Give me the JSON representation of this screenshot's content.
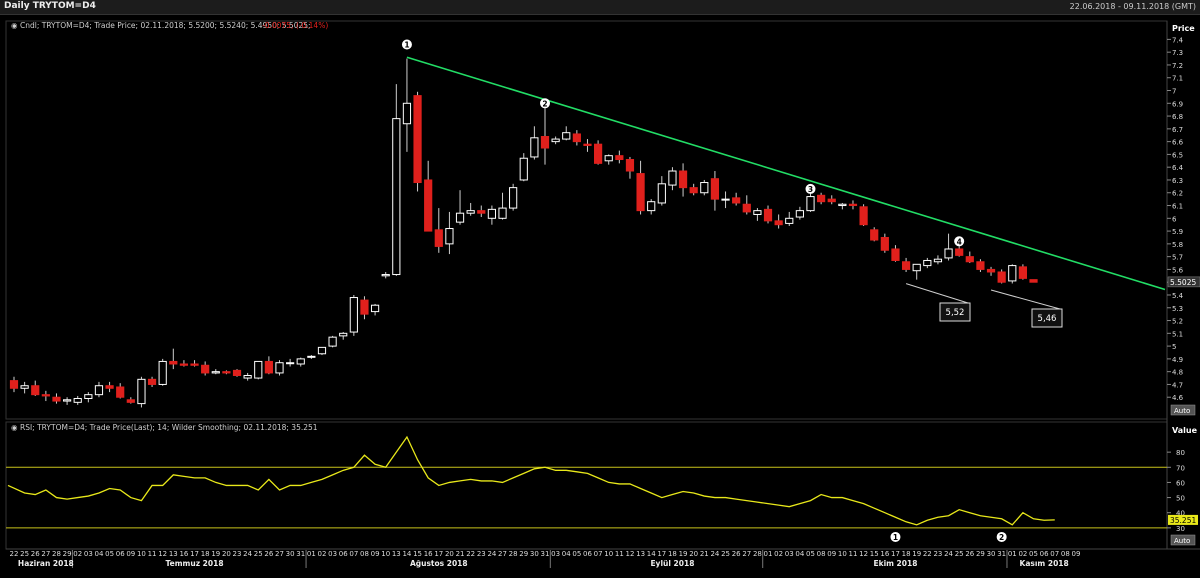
{
  "window": {
    "title": "Daily TRYTOM=D4",
    "date_range": "22.06.2018 - 09.11.2018 (GMT)"
  },
  "colors": {
    "up": "#ffffff",
    "down": "#e0201c",
    "trend": "#22dd66",
    "rsi": "#e8e81a",
    "band": "#c8c21a",
    "bg": "#000000",
    "grid": "#2a2a2a"
  },
  "chart_data": [
    {
      "type": "candlestick",
      "legend_prefix": "Cndl; TRYTOM=D4; Trade Price; 02.11.2018; 5.5200; 5.5240; 5.4950; 5.5025;",
      "legend_change": "-0.0075; (-0.14%)",
      "y_title": "Price",
      "ylim": [
        4.5,
        7.45
      ],
      "y_ticks": [
        "4.6",
        "4.7",
        "4.8",
        "4.9",
        "5",
        "5.1",
        "5.2",
        "5.3",
        "5.4",
        "5.5",
        "5.6",
        "5.7",
        "5.8",
        "5.9",
        "6",
        "6.1",
        "6.2",
        "6.3",
        "6.4",
        "6.5",
        "6.6",
        "6.7",
        "6.8",
        "6.9",
        "7",
        "7.1",
        "7.2",
        "7.3",
        "7.4"
      ],
      "last_price": "5.5025",
      "scale_button": "Auto",
      "ohlc": [
        [
          4.73,
          4.76,
          4.64,
          4.67
        ],
        [
          4.67,
          4.72,
          4.63,
          4.69
        ],
        [
          4.69,
          4.73,
          4.61,
          4.62
        ],
        [
          4.62,
          4.65,
          4.57,
          4.61
        ],
        [
          4.6,
          4.63,
          4.55,
          4.57
        ],
        [
          4.57,
          4.6,
          4.54,
          4.58
        ],
        [
          4.56,
          4.61,
          4.54,
          4.59
        ],
        [
          4.59,
          4.64,
          4.56,
          4.62
        ],
        [
          4.62,
          4.72,
          4.6,
          4.69
        ],
        [
          4.69,
          4.72,
          4.64,
          4.67
        ],
        [
          4.68,
          4.71,
          4.59,
          4.6
        ],
        [
          4.58,
          4.6,
          4.55,
          4.56
        ],
        [
          4.55,
          4.76,
          4.52,
          4.74
        ],
        [
          4.74,
          4.76,
          4.68,
          4.7
        ],
        [
          4.7,
          4.9,
          4.69,
          4.88
        ],
        [
          4.88,
          4.98,
          4.82,
          4.86
        ],
        [
          4.86,
          4.89,
          4.84,
          4.85
        ],
        [
          4.86,
          4.89,
          4.84,
          4.85
        ],
        [
          4.85,
          4.88,
          4.77,
          4.79
        ],
        [
          4.79,
          4.82,
          4.78,
          4.8
        ],
        [
          4.8,
          4.81,
          4.78,
          4.79
        ],
        [
          4.81,
          4.82,
          4.76,
          4.77
        ],
        [
          4.75,
          4.79,
          4.73,
          4.77
        ],
        [
          4.75,
          4.88,
          4.74,
          4.88
        ],
        [
          4.88,
          4.92,
          4.78,
          4.79
        ],
        [
          4.79,
          4.89,
          4.77,
          4.87
        ],
        [
          4.87,
          4.9,
          4.84,
          4.87
        ],
        [
          4.86,
          4.91,
          4.84,
          4.9
        ],
        [
          4.92,
          4.93,
          4.9,
          4.92
        ],
        [
          4.94,
          4.99,
          4.93,
          4.99
        ],
        [
          5.0,
          5.08,
          4.99,
          5.07
        ],
        [
          5.08,
          5.11,
          5.05,
          5.1
        ],
        [
          5.11,
          5.4,
          5.08,
          5.38
        ],
        [
          5.36,
          5.39,
          5.21,
          5.25
        ],
        [
          5.27,
          5.33,
          5.24,
          5.32
        ],
        [
          5.55,
          5.58,
          5.53,
          5.56
        ],
        [
          5.56,
          7.05,
          5.55,
          6.78
        ],
        [
          6.74,
          7.25,
          6.52,
          6.9
        ],
        [
          6.96,
          6.99,
          6.21,
          6.28
        ],
        [
          6.3,
          6.45,
          5.96,
          5.9
        ],
        [
          5.91,
          6.08,
          5.73,
          5.78
        ],
        [
          5.8,
          6.05,
          5.72,
          5.92
        ],
        [
          5.97,
          6.22,
          5.95,
          6.04
        ],
        [
          6.04,
          6.12,
          6.02,
          6.06
        ],
        [
          6.06,
          6.1,
          6.01,
          6.04
        ],
        [
          6.0,
          6.1,
          5.95,
          6.07
        ],
        [
          6.0,
          6.2,
          5.99,
          6.08
        ],
        [
          6.08,
          6.27,
          6.06,
          6.24
        ],
        [
          6.3,
          6.51,
          6.29,
          6.47
        ],
        [
          6.48,
          6.72,
          6.46,
          6.63
        ],
        [
          6.64,
          6.87,
          6.42,
          6.55
        ],
        [
          6.6,
          6.64,
          6.58,
          6.62
        ],
        [
          6.62,
          6.72,
          6.61,
          6.67
        ],
        [
          6.66,
          6.69,
          6.57,
          6.6
        ],
        [
          6.58,
          6.62,
          6.52,
          6.57
        ],
        [
          6.58,
          6.61,
          6.42,
          6.43
        ],
        [
          6.45,
          6.5,
          6.42,
          6.49
        ],
        [
          6.49,
          6.53,
          6.43,
          6.46
        ],
        [
          6.46,
          6.48,
          6.31,
          6.37
        ],
        [
          6.35,
          6.45,
          6.03,
          6.06
        ],
        [
          6.06,
          6.15,
          6.03,
          6.13
        ],
        [
          6.12,
          6.33,
          6.1,
          6.27
        ],
        [
          6.26,
          6.4,
          6.22,
          6.37
        ],
        [
          6.37,
          6.43,
          6.17,
          6.24
        ],
        [
          6.24,
          6.27,
          6.18,
          6.2
        ],
        [
          6.2,
          6.3,
          6.18,
          6.28
        ],
        [
          6.31,
          6.37,
          6.06,
          6.15
        ],
        [
          6.15,
          6.21,
          6.08,
          6.15
        ],
        [
          6.16,
          6.2,
          6.1,
          6.12
        ],
        [
          6.11,
          6.18,
          6.03,
          6.05
        ],
        [
          6.03,
          6.08,
          5.98,
          6.06
        ],
        [
          6.07,
          6.1,
          5.96,
          5.98
        ],
        [
          5.98,
          6.03,
          5.92,
          5.95
        ],
        [
          5.96,
          6.05,
          5.94,
          6.0
        ],
        [
          6.01,
          6.09,
          5.99,
          6.06
        ],
        [
          6.06,
          6.25,
          6.05,
          6.17
        ],
        [
          6.18,
          6.2,
          6.11,
          6.13
        ],
        [
          6.15,
          6.18,
          6.11,
          6.13
        ],
        [
          6.1,
          6.12,
          6.07,
          6.11
        ],
        [
          6.11,
          6.14,
          6.07,
          6.1
        ],
        [
          6.09,
          6.11,
          5.94,
          5.95
        ],
        [
          5.91,
          5.93,
          5.82,
          5.83
        ],
        [
          5.85,
          5.88,
          5.73,
          5.75
        ],
        [
          5.76,
          5.79,
          5.66,
          5.67
        ],
        [
          5.66,
          5.69,
          5.58,
          5.6
        ],
        [
          5.59,
          5.64,
          5.52,
          5.64
        ],
        [
          5.63,
          5.69,
          5.61,
          5.67
        ],
        [
          5.66,
          5.71,
          5.64,
          5.68
        ],
        [
          5.69,
          5.88,
          5.67,
          5.76
        ],
        [
          5.76,
          5.79,
          5.7,
          5.71
        ],
        [
          5.7,
          5.74,
          5.65,
          5.66
        ],
        [
          5.66,
          5.68,
          5.58,
          5.6
        ],
        [
          5.6,
          5.62,
          5.55,
          5.58
        ],
        [
          5.58,
          5.6,
          5.49,
          5.5
        ],
        [
          5.51,
          5.64,
          5.49,
          5.63
        ],
        [
          5.62,
          5.64,
          5.52,
          5.53
        ],
        [
          5.52,
          5.52,
          5.5,
          5.5
        ]
      ],
      "trendline": {
        "from": [
          37,
          7.26
        ],
        "to": [
          103,
          5.58
        ]
      },
      "annotations": [
        {
          "label": "1",
          "index": 37,
          "price": 7.36
        },
        {
          "label": "2",
          "index": 50,
          "price": 6.9
        },
        {
          "label": "3",
          "index": 75,
          "price": 6.23
        },
        {
          "label": "4",
          "index": 89,
          "price": 5.82
        }
      ],
      "callouts": [
        {
          "text": "5,52",
          "index": 84,
          "price": 5.52
        },
        {
          "text": "5,46",
          "index": 92,
          "price": 5.47
        }
      ]
    },
    {
      "type": "line",
      "legend_text": "RSI; TRYTOM=D4; Trade Price(Last); 14; Wilder Smoothing; 02.11.2018; 35.251",
      "y_title": "Value",
      "ylim": [
        20,
        90
      ],
      "y_ticks": [
        "30",
        "40",
        "50",
        "60",
        "70",
        "80"
      ],
      "bands": [
        30,
        70
      ],
      "last_value": "35.251",
      "scale_button": "Auto",
      "values": [
        58,
        53,
        52,
        55,
        50,
        49,
        50,
        51,
        53,
        56,
        55,
        50,
        48,
        58,
        58,
        65,
        64,
        63,
        63,
        60,
        58,
        58,
        58,
        55,
        62,
        55,
        58,
        58,
        60,
        62,
        65,
        68,
        70,
        78,
        72,
        70,
        80,
        90,
        75,
        63,
        58,
        60,
        61,
        62,
        61,
        61,
        60,
        63,
        66,
        69,
        70,
        68,
        68,
        67,
        66,
        63,
        60,
        59,
        59,
        56,
        53,
        50,
        52,
        54,
        53,
        51,
        50,
        50,
        49,
        48,
        47,
        46,
        45,
        44,
        46,
        48,
        52,
        50,
        50,
        48,
        46,
        43,
        40,
        37,
        34,
        32,
        35,
        37,
        38,
        42,
        40,
        38,
        37,
        36,
        32,
        40,
        36,
        35,
        35.251
      ],
      "annotations": [
        {
          "label": "1",
          "index": 83,
          "value": 24
        },
        {
          "label": "2",
          "index": 93,
          "value": 24
        }
      ]
    }
  ],
  "x_axis": {
    "day_labels": [
      "22",
      "25",
      "26",
      "27",
      "28",
      "29",
      "02",
      "03",
      "04",
      "05",
      "06",
      "09",
      "10",
      "11",
      "12",
      "13",
      "16",
      "17",
      "18",
      "19",
      "20",
      "23",
      "24",
      "25",
      "26",
      "27",
      "30",
      "31",
      "01",
      "02",
      "03",
      "06",
      "07",
      "08",
      "09",
      "10",
      "13",
      "14",
      "15",
      "16",
      "17",
      "20",
      "21",
      "22",
      "23",
      "24",
      "27",
      "28",
      "29",
      "30",
      "31",
      "03",
      "04",
      "05",
      "06",
      "07",
      "10",
      "11",
      "12",
      "13",
      "14",
      "17",
      "18",
      "19",
      "20",
      "21",
      "24",
      "25",
      "26",
      "27",
      "28",
      "01",
      "02",
      "03",
      "04",
      "05",
      "08",
      "09",
      "10",
      "11",
      "12",
      "15",
      "16",
      "17",
      "18",
      "19",
      "22",
      "23",
      "24",
      "25",
      "26",
      "29",
      "30",
      "31",
      "01",
      "02",
      "05",
      "06",
      "07",
      "08",
      "09"
    ],
    "months": [
      {
        "label": "Haziran 2018",
        "index": 3
      },
      {
        "label": "Temmuz 2018",
        "index": 17
      },
      {
        "label": "Ağustos 2018",
        "index": 40
      },
      {
        "label": "Eylül 2018",
        "index": 62
      },
      {
        "label": "Ekim 2018",
        "index": 83
      },
      {
        "label": "Kasım 2018",
        "index": 97
      }
    ],
    "month_dividers": [
      6,
      28,
      51,
      71,
      94
    ]
  }
}
